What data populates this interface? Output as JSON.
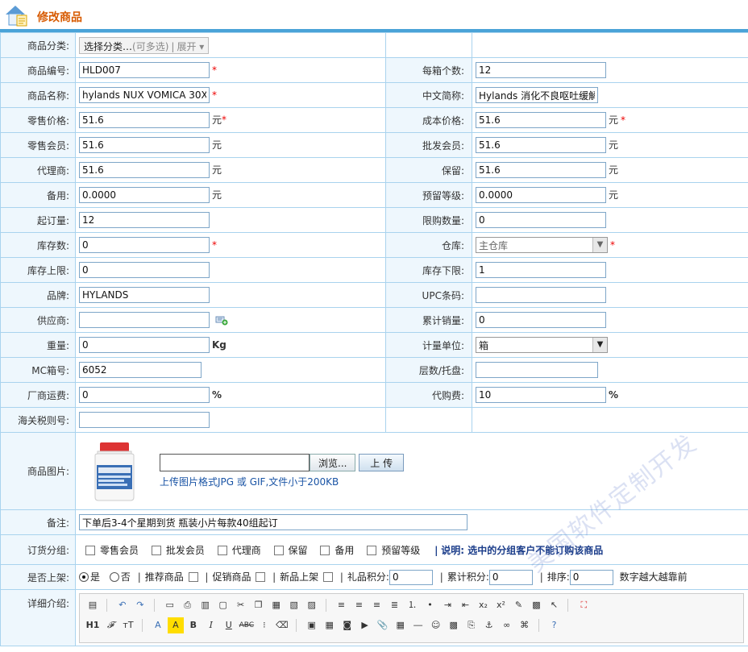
{
  "page": {
    "title": "修改商品"
  },
  "fields": {
    "category": {
      "label": "商品分类:",
      "button": "选择分类…",
      "hint": "(可多选)",
      "expand": "展开"
    },
    "code": {
      "label": "商品编号:",
      "value": "HLD007"
    },
    "box_count": {
      "label": "每箱个数:",
      "value": "12"
    },
    "name": {
      "label": "商品名称:",
      "value": "hylands NUX VOMICA 30X"
    },
    "cn_short": {
      "label": "中文简称:",
      "value": "Hylands 消化不良呕吐缓解"
    },
    "retail_price": {
      "label": "零售价格:",
      "value": "51.6",
      "unit": "元"
    },
    "cost_price": {
      "label": "成本价格:",
      "value": "51.6",
      "unit": "元"
    },
    "retail_member": {
      "label": "零售会员:",
      "value": "51.6",
      "unit": "元"
    },
    "wholesale_member": {
      "label": "批发会员:",
      "value": "51.6",
      "unit": "元"
    },
    "agent": {
      "label": "代理商:",
      "value": "51.6",
      "unit": "元"
    },
    "reserve": {
      "label": "保留:",
      "value": "51.6",
      "unit": "元"
    },
    "spare": {
      "label": "备用:",
      "value": "0.0000",
      "unit": "元"
    },
    "reserve_level": {
      "label": "预留等级:",
      "value": "0.0000",
      "unit": "元"
    },
    "min_order": {
      "label": "起订量:",
      "value": "12"
    },
    "purchase_limit": {
      "label": "限购数量:",
      "value": "0"
    },
    "stock": {
      "label": "库存数:",
      "value": "0"
    },
    "warehouse": {
      "label": "仓库:",
      "value": "主仓库"
    },
    "stock_max": {
      "label": "库存上限:",
      "value": "0"
    },
    "stock_min": {
      "label": "库存下限:",
      "value": "1"
    },
    "brand": {
      "label": "品牌:",
      "value": "HYLANDS"
    },
    "upc": {
      "label": "UPC条码:",
      "value": ""
    },
    "supplier": {
      "label": "供应商:",
      "value": ""
    },
    "total_sales": {
      "label": "累计销量:",
      "value": "0"
    },
    "weight": {
      "label": "重量:",
      "value": "0",
      "unit": "Kg"
    },
    "measure_unit": {
      "label": "计量单位:",
      "value": "箱"
    },
    "mc_box": {
      "label": "MC箱号:",
      "value": "6052"
    },
    "layers": {
      "label": "层数/托盘:",
      "value": ""
    },
    "freight": {
      "label": "厂商运费:",
      "value": "0",
      "unit": "%"
    },
    "purchase_fee": {
      "label": "代购费:",
      "value": "10",
      "unit": "%"
    },
    "hs_code": {
      "label": "海关税则号:",
      "value": ""
    },
    "image": {
      "label": "商品图片:",
      "browse": "浏览...",
      "upload": "上 传",
      "hint": "上传图片格式JPG 或 GIF,文件小于200KB"
    },
    "remark": {
      "label": "备注:",
      "value": "下单后3-4个星期到货 瓶装小片每款40组起订"
    },
    "order_group": {
      "label": "订货分组:",
      "options": [
        "零售会员",
        "批发会员",
        "代理商",
        "保留",
        "备用",
        "预留等级"
      ],
      "note": "说明: 选中的分组客户不能订购该商品"
    },
    "shelf": {
      "label": "是否上架:",
      "yes": "是",
      "no": "否",
      "recommend": "推荐商品",
      "promo": "促销商品",
      "new": "新品上架",
      "gift_points": "礼品积分:",
      "gift_points_value": "0",
      "acc_points": "累计积分:",
      "acc_points_value": "0",
      "sort": "排序:",
      "sort_value": "0",
      "sort_hint": "数字越大越靠前"
    },
    "detail": {
      "label": "详细介绍:"
    }
  },
  "required_mark": "*",
  "watermark": "美国软件定制开发"
}
